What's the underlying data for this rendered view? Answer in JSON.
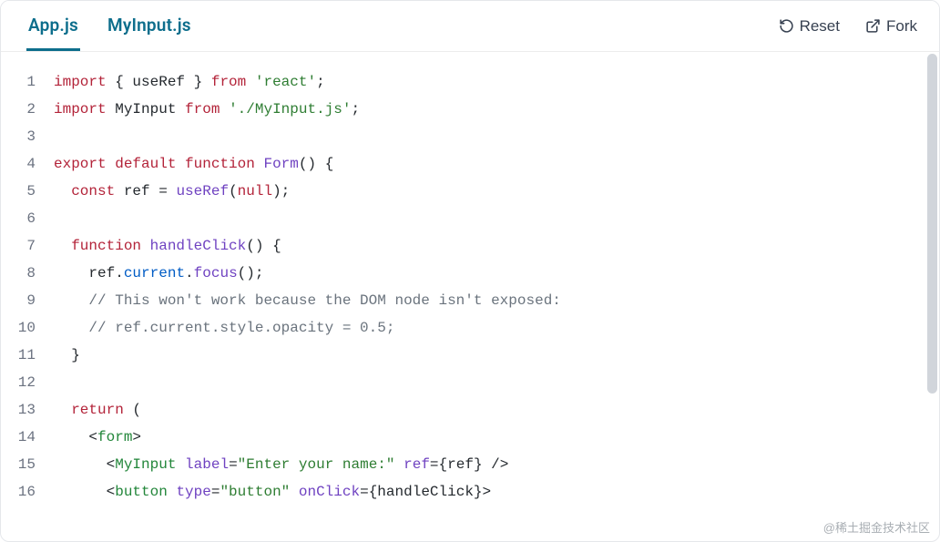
{
  "tabs": [
    {
      "label": "App.js",
      "active": true
    },
    {
      "label": "MyInput.js",
      "active": false
    }
  ],
  "toolbar": {
    "reset_label": "Reset",
    "fork_label": "Fork"
  },
  "code": [
    {
      "n": 1,
      "tokens": [
        {
          "t": "import",
          "c": "kw"
        },
        {
          "t": " ",
          "c": "plain"
        },
        {
          "t": "{ useRef }",
          "c": "plain"
        },
        {
          "t": " ",
          "c": "plain"
        },
        {
          "t": "from",
          "c": "kw"
        },
        {
          "t": " ",
          "c": "plain"
        },
        {
          "t": "'react'",
          "c": "str"
        },
        {
          "t": ";",
          "c": "punct"
        }
      ]
    },
    {
      "n": 2,
      "tokens": [
        {
          "t": "import",
          "c": "kw"
        },
        {
          "t": " ",
          "c": "plain"
        },
        {
          "t": "MyInput",
          "c": "plain"
        },
        {
          "t": " ",
          "c": "plain"
        },
        {
          "t": "from",
          "c": "kw"
        },
        {
          "t": " ",
          "c": "plain"
        },
        {
          "t": "'./MyInput.js'",
          "c": "str"
        },
        {
          "t": ";",
          "c": "punct"
        }
      ]
    },
    {
      "n": 3,
      "tokens": []
    },
    {
      "n": 4,
      "tokens": [
        {
          "t": "export",
          "c": "kw"
        },
        {
          "t": " ",
          "c": "plain"
        },
        {
          "t": "default",
          "c": "kw"
        },
        {
          "t": " ",
          "c": "plain"
        },
        {
          "t": "function",
          "c": "kw"
        },
        {
          "t": " ",
          "c": "plain"
        },
        {
          "t": "Form",
          "c": "fn"
        },
        {
          "t": "()",
          "c": "punct"
        },
        {
          "t": " ",
          "c": "plain"
        },
        {
          "t": "{",
          "c": "punct"
        }
      ]
    },
    {
      "n": 5,
      "tokens": [
        {
          "t": "  ",
          "c": "plain"
        },
        {
          "t": "const",
          "c": "kw"
        },
        {
          "t": " ref ",
          "c": "plain"
        },
        {
          "t": "=",
          "c": "punct"
        },
        {
          "t": " ",
          "c": "plain"
        },
        {
          "t": "useRef",
          "c": "fn"
        },
        {
          "t": "(",
          "c": "punct"
        },
        {
          "t": "null",
          "c": "kw"
        },
        {
          "t": ");",
          "c": "punct"
        }
      ]
    },
    {
      "n": 6,
      "tokens": []
    },
    {
      "n": 7,
      "tokens": [
        {
          "t": "  ",
          "c": "plain"
        },
        {
          "t": "function",
          "c": "kw"
        },
        {
          "t": " ",
          "c": "plain"
        },
        {
          "t": "handleClick",
          "c": "fn"
        },
        {
          "t": "()",
          "c": "punct"
        },
        {
          "t": " ",
          "c": "plain"
        },
        {
          "t": "{",
          "c": "punct"
        }
      ]
    },
    {
      "n": 8,
      "tokens": [
        {
          "t": "    ref",
          "c": "plain"
        },
        {
          "t": ".",
          "c": "punct"
        },
        {
          "t": "current",
          "c": "prop"
        },
        {
          "t": ".",
          "c": "punct"
        },
        {
          "t": "focus",
          "c": "fn"
        },
        {
          "t": "();",
          "c": "punct"
        }
      ]
    },
    {
      "n": 9,
      "tokens": [
        {
          "t": "    ",
          "c": "plain"
        },
        {
          "t": "// This won't work because the DOM node isn't exposed:",
          "c": "comment"
        }
      ]
    },
    {
      "n": 10,
      "tokens": [
        {
          "t": "    ",
          "c": "plain"
        },
        {
          "t": "// ref.current.style.opacity = 0.5;",
          "c": "comment"
        }
      ]
    },
    {
      "n": 11,
      "tokens": [
        {
          "t": "  }",
          "c": "punct"
        }
      ]
    },
    {
      "n": 12,
      "tokens": []
    },
    {
      "n": 13,
      "tokens": [
        {
          "t": "  ",
          "c": "plain"
        },
        {
          "t": "return",
          "c": "kw"
        },
        {
          "t": " (",
          "c": "punct"
        }
      ]
    },
    {
      "n": 14,
      "tokens": [
        {
          "t": "    ",
          "c": "plain"
        },
        {
          "t": "<",
          "c": "punct"
        },
        {
          "t": "form",
          "c": "tag"
        },
        {
          "t": ">",
          "c": "punct"
        }
      ]
    },
    {
      "n": 15,
      "tokens": [
        {
          "t": "      ",
          "c": "plain"
        },
        {
          "t": "<",
          "c": "punct"
        },
        {
          "t": "MyInput",
          "c": "tag"
        },
        {
          "t": " ",
          "c": "plain"
        },
        {
          "t": "label",
          "c": "attr"
        },
        {
          "t": "=",
          "c": "punct"
        },
        {
          "t": "\"Enter your name:\"",
          "c": "str"
        },
        {
          "t": " ",
          "c": "plain"
        },
        {
          "t": "ref",
          "c": "attr"
        },
        {
          "t": "=",
          "c": "punct"
        },
        {
          "t": "{ref}",
          "c": "plain"
        },
        {
          "t": " />",
          "c": "punct"
        }
      ]
    },
    {
      "n": 16,
      "tokens": [
        {
          "t": "      ",
          "c": "plain"
        },
        {
          "t": "<",
          "c": "punct"
        },
        {
          "t": "button",
          "c": "tag"
        },
        {
          "t": " ",
          "c": "plain"
        },
        {
          "t": "type",
          "c": "attr"
        },
        {
          "t": "=",
          "c": "punct"
        },
        {
          "t": "\"button\"",
          "c": "str"
        },
        {
          "t": " ",
          "c": "plain"
        },
        {
          "t": "onClick",
          "c": "attr"
        },
        {
          "t": "=",
          "c": "punct"
        },
        {
          "t": "{handleClick}",
          "c": "plain"
        },
        {
          "t": ">",
          "c": "punct"
        }
      ]
    }
  ],
  "watermark": "@稀土掘金技术社区"
}
